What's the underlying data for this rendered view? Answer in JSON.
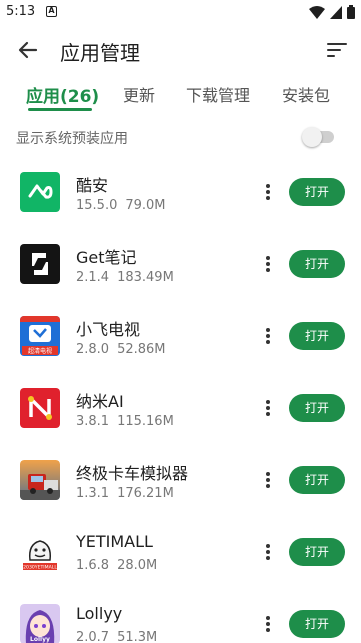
{
  "status_bar": {
    "time": "5:13",
    "notification_letter": "A"
  },
  "header": {
    "title": "应用管理"
  },
  "tabs": [
    {
      "label": "应用(26)",
      "active": true
    },
    {
      "label": "更新",
      "active": false
    },
    {
      "label": "下载管理",
      "active": false
    },
    {
      "label": "安装包",
      "active": false
    }
  ],
  "system_toggle": {
    "label": "显示系统预装应用",
    "enabled": false
  },
  "apps": [
    {
      "name": "酷安",
      "version": "15.5.0",
      "size": "79.0M",
      "action": "打开",
      "icon": "coolapk-icon"
    },
    {
      "name": "Get笔记",
      "version": "2.1.4",
      "size": "183.49M",
      "action": "打开",
      "icon": "getnote-icon"
    },
    {
      "name": "小飞电视",
      "version": "2.8.0",
      "size": "52.86M",
      "action": "打开",
      "icon": "tv-icon",
      "icon_text": "超清电视"
    },
    {
      "name": "纳米AI",
      "version": "3.8.1",
      "size": "115.16M",
      "action": "打开",
      "icon": "nano-ai-icon"
    },
    {
      "name": "终极卡车模拟器",
      "version": "1.3.1",
      "size": "176.21M",
      "action": "打开",
      "icon": "truck-icon"
    },
    {
      "name": "YETIMALL",
      "version": "1.6.8",
      "size": "28.0M",
      "action": "打开",
      "icon": "yeti-icon",
      "icon_text": "2030YETIMALL"
    },
    {
      "name": "Lollyy",
      "version": "2.0.7",
      "size": "51.3M",
      "action": "打开",
      "icon": "lollyy-icon",
      "icon_text": "Lollyy"
    }
  ],
  "colors": {
    "accent": "#1e8e4a",
    "toggle_off": "#cfcfcf"
  }
}
